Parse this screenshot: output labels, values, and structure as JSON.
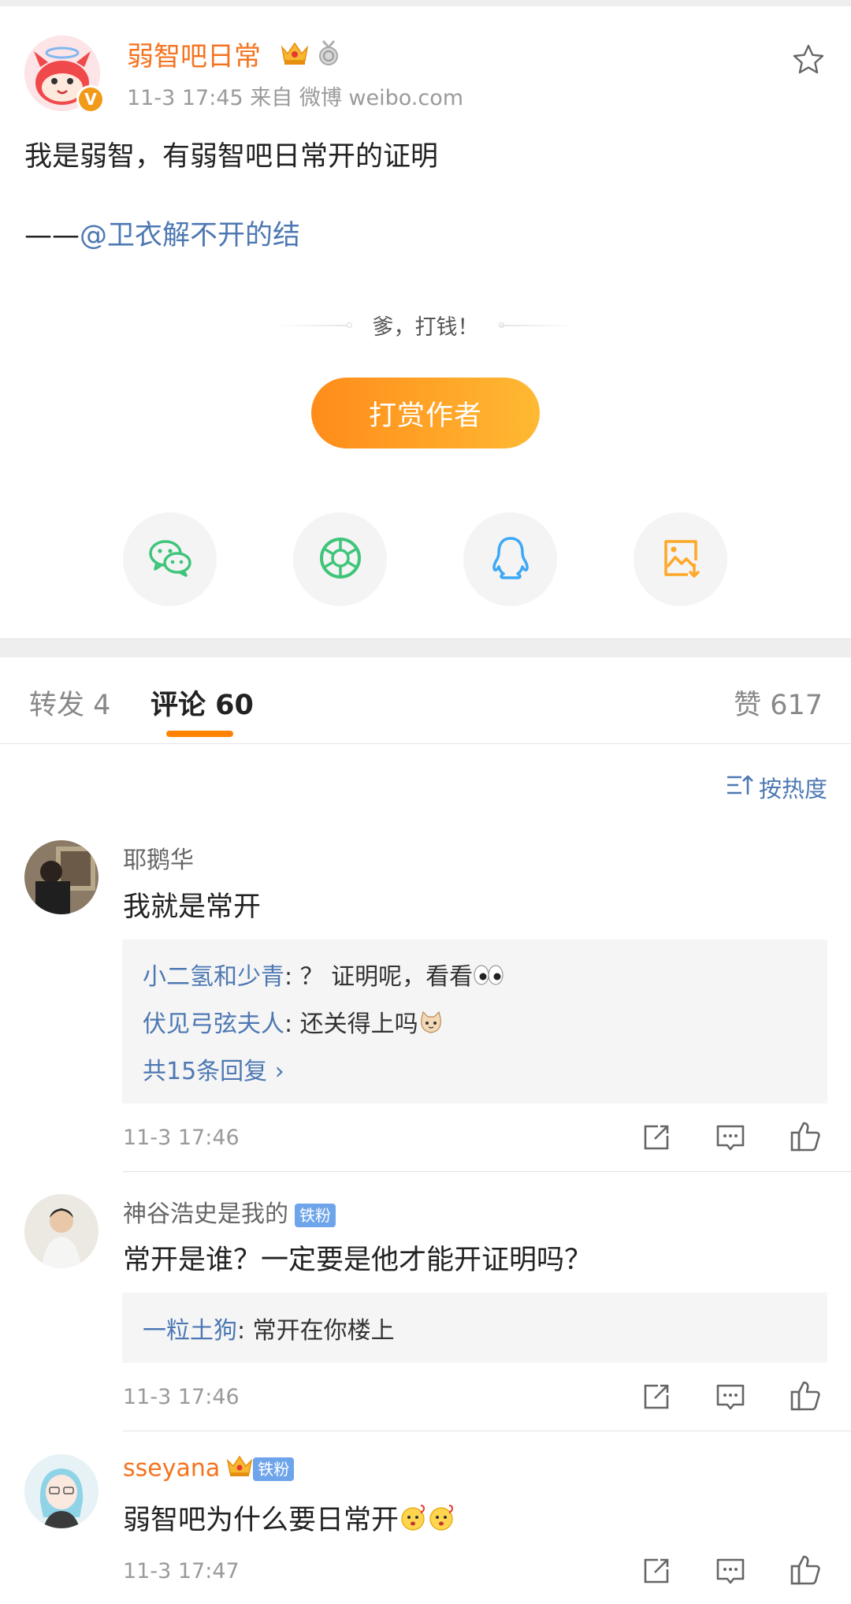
{
  "post": {
    "author": "弱智吧日常",
    "meta": "11-3 17:45   来自 微博 weibo.com",
    "line1": "我是弱智，有弱智吧日常开的证明",
    "dash": "——",
    "mention": "@卫衣解不开的结",
    "tip_text": "爹，打钱！",
    "reward_label": "打赏作者",
    "verified_label": "V"
  },
  "share": [
    {
      "name": "wechat-icon",
      "color": "#3ec57a"
    },
    {
      "name": "moments-icon",
      "color": "#3ec57a"
    },
    {
      "name": "qq-icon",
      "color": "#3da8f5"
    },
    {
      "name": "save-image-icon",
      "color": "#ffa726"
    }
  ],
  "tabs": {
    "repost": "转发 4",
    "comments": "评论 60",
    "likes": "赞 617"
  },
  "sort_label": "按热度",
  "comments": [
    {
      "user": "耶鹅华",
      "text": "我就是常开",
      "replies": [
        {
          "user": "小二氢和少青",
          "text": ": ？ 证明呢，看看"
        },
        {
          "user": "伏见弓弦夫人",
          "text": ": 还关得上吗"
        }
      ],
      "more": "共15条回复  ›",
      "time": "11-3 17:46"
    },
    {
      "user": "神谷浩史是我的",
      "badge": "铁粉",
      "text": "常开是谁？一定要是他才能开证明吗？",
      "replies": [
        {
          "user": "一粒土狗",
          "text": ": 常开在你楼上"
        }
      ],
      "time": "11-3 17:46"
    },
    {
      "user": "sseyana",
      "badge": "铁粉",
      "text": "弱智吧为什么要日常开",
      "time": "11-3 17:47"
    }
  ]
}
